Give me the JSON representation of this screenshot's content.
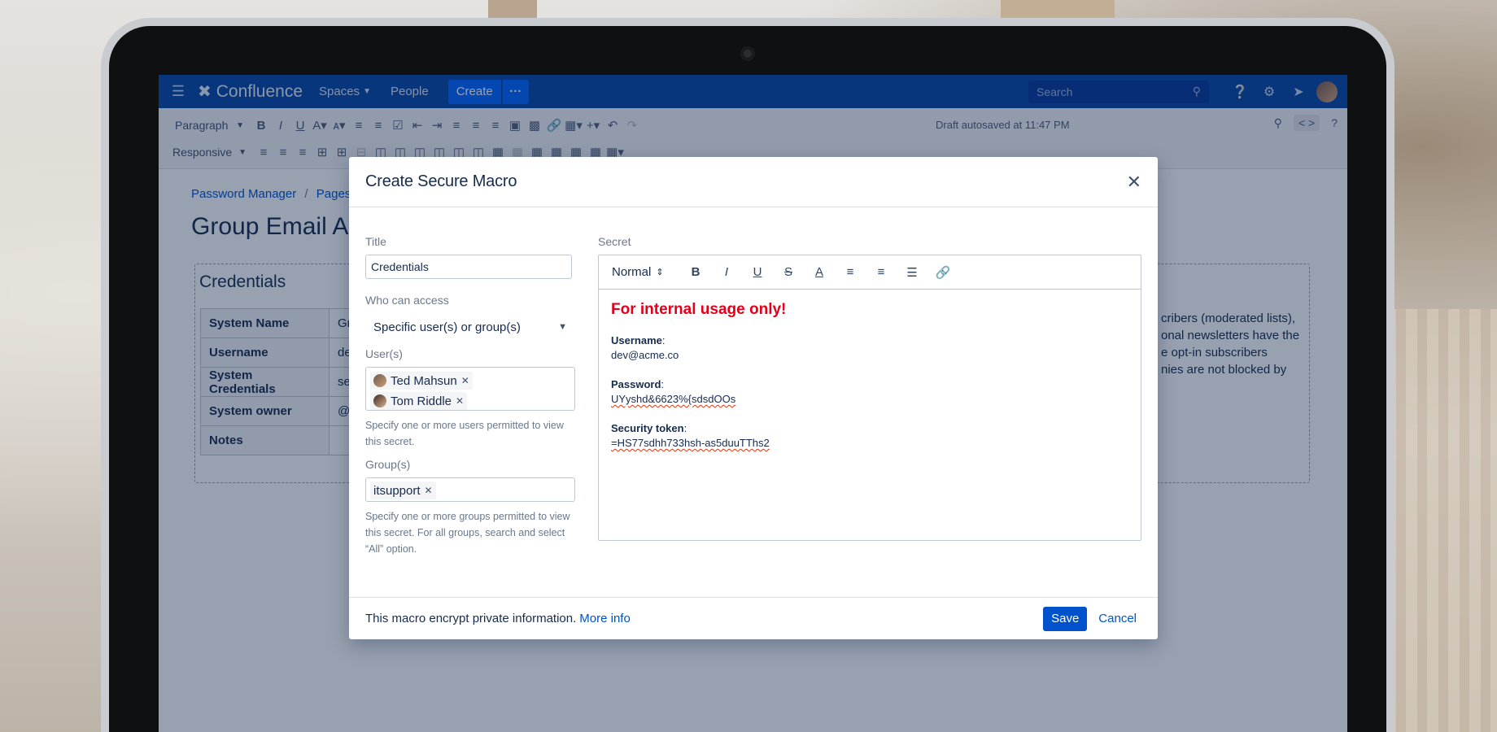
{
  "topnav": {
    "app_name": "Confluence",
    "spaces_label": "Spaces",
    "people_label": "People",
    "create_label": "Create",
    "more_label": "···",
    "search_placeholder": "Search"
  },
  "toolbar": {
    "paragraph_label": "Paragraph",
    "responsive_label": "Responsive",
    "draft_status": "Draft autosaved at 11:47 PM"
  },
  "page": {
    "breadcrumb": [
      "Password Manager",
      "Pages"
    ],
    "title": "Group Email Ac",
    "panel_title": "Credentials",
    "rows": [
      {
        "key": "System Name",
        "value": "Gr"
      },
      {
        "key": "Username",
        "value": "de"
      },
      {
        "key": "System Credentials",
        "value": "se"
      },
      {
        "key": "System owner",
        "value": "@"
      },
      {
        "key": "Notes",
        "value": ""
      }
    ],
    "side_text": [
      "cribers (moderated lists),",
      "onal newsletters have the",
      "e opt-in subscribers",
      "nies are not blocked by"
    ]
  },
  "modal": {
    "title": "Create Secure Macro",
    "title_label": "Title",
    "title_value": "Credentials",
    "access_label": "Who can access",
    "access_value": "Specific user(s) or group(s)",
    "users_label": "User(s)",
    "users": [
      "Ted Mahsun",
      "Tom Riddle"
    ],
    "users_hint": "Specify one or more users permitted to view this secret.",
    "groups_label": "Group(s)",
    "groups": [
      "itsupport"
    ],
    "groups_hint": "Specify one or more groups permitted to view this secret. For all groups, search and select “All” option.",
    "secret_label": "Secret",
    "format_value": "Normal",
    "secret": {
      "warning": "For internal usage only!",
      "username_label": "Username",
      "username_value": "dev@acme.co",
      "password_label": "Password",
      "password_value": "UYyshd&6623%{sdsdOOs",
      "token_label": "Security token",
      "token_value": "=HS77sdhh733hsh-as5duuTThs2"
    },
    "footer_text": "This macro encrypt private information.",
    "more_info": "More info",
    "save_label": "Save",
    "cancel_label": "Cancel"
  }
}
